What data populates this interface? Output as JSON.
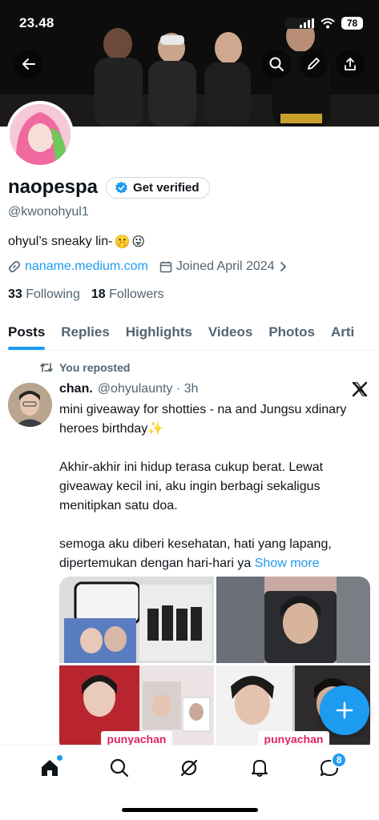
{
  "status_bar": {
    "time": "23.48",
    "battery": "78"
  },
  "profile": {
    "name": "naopespa",
    "verify_label": "Get verified",
    "handle": "@kwonohyul1",
    "bio": "ohyul’s sneaky lin-",
    "bio_emojis": [
      "🤫",
      "😜"
    ],
    "link": "naname.medium.com",
    "joined": "Joined April 2024",
    "following_count": "33",
    "following_label": "Following",
    "followers_count": "18",
    "followers_label": "Followers"
  },
  "tabs": [
    {
      "label": "Posts"
    },
    {
      "label": "Replies"
    },
    {
      "label": "Highlights"
    },
    {
      "label": "Videos"
    },
    {
      "label": "Photos"
    },
    {
      "label": "Arti"
    }
  ],
  "post": {
    "repost_label": "You reposted",
    "author": "chan.",
    "handle_time": "@ohyulaunty · 3h",
    "paragraphs": [
      "mini giveaway for shotties - na and Jungsu xdinary heroes birthday✨",
      "Akhir-akhir ini hidup terasa cukup berat. Lewat giveaway kecil ini, aku ingin berbagi sekaligus menitipkan satu doa.",
      "semoga aku diberi kesehatan, hati yang lapang, dipertemukan dengan hari-hari ya"
    ],
    "show_more": "Show more",
    "media_tags": [
      "punyachan",
      "punyachan"
    ]
  },
  "bottom_nav": {
    "messages_badge": "8"
  },
  "colors": {
    "accent": "#1d9bf0",
    "text": "#0f1419",
    "secondary": "#536471"
  }
}
